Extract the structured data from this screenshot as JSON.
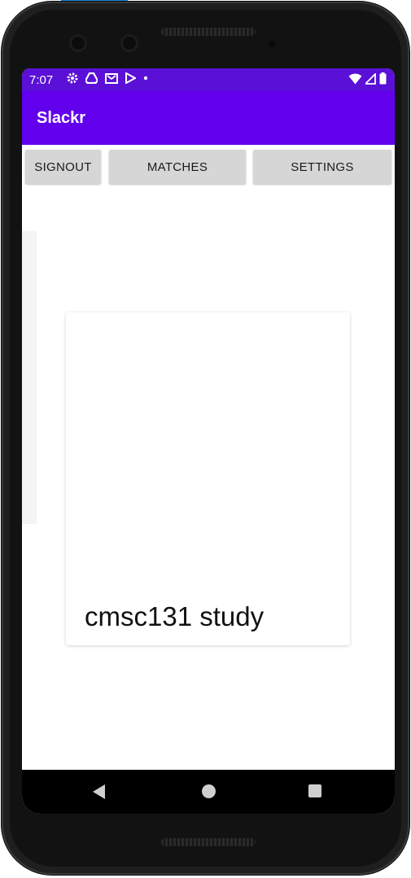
{
  "status_bar": {
    "time": "7:07",
    "icons": [
      "gear-icon",
      "drive-icon",
      "gmail-icon",
      "play-store-icon",
      "dot-icon"
    ],
    "right_icons": [
      "wifi-icon",
      "signal-icon",
      "battery-icon"
    ]
  },
  "app_bar": {
    "title": "Slackr"
  },
  "toolbar": {
    "signout_label": "SIGNOUT",
    "matches_label": "MATCHES",
    "settings_label": "SETTINGS"
  },
  "card": {
    "title": "cmsc131 study"
  },
  "nav_bar": {
    "icons": [
      "back-icon",
      "home-icon",
      "recents-icon"
    ]
  },
  "colors": {
    "status_bar": "#5a10d6",
    "app_bar": "#6200ee",
    "button_bg": "#d6d6d6"
  }
}
